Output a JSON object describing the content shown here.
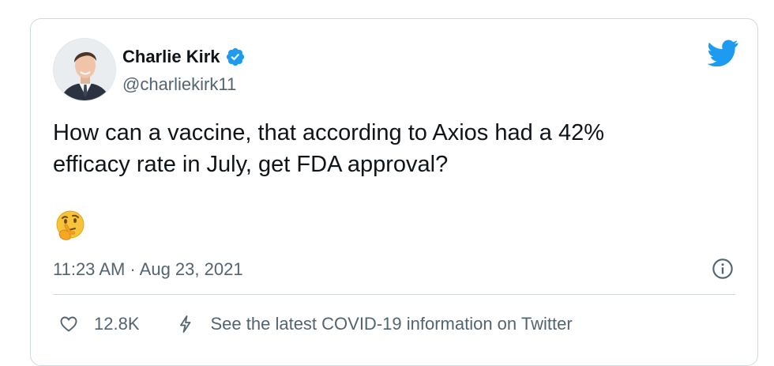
{
  "author": {
    "display_name": "Charlie Kirk",
    "handle": "@charliekirk11",
    "verified": true
  },
  "tweet": {
    "text": "How can a vaccine, that according to Axios had a 42%\nefficacy rate in July, get FDA approval?",
    "emoji": "thinking-face",
    "timestamp": "11:23 AM · Aug 23, 2021"
  },
  "actions": {
    "like_count": "12.8K",
    "covid_info_label": "See the latest COVID-19 information on Twitter"
  },
  "icons": {
    "brand": "twitter-bird-icon",
    "verified": "verified-badge-icon",
    "info": "info-icon",
    "like": "heart-icon",
    "covid": "lightning-bolt-icon"
  },
  "colors": {
    "brand_blue": "#1d9bf0",
    "text_primary": "#0f1419",
    "text_secondary": "#536471",
    "border": "#cfd9de"
  }
}
